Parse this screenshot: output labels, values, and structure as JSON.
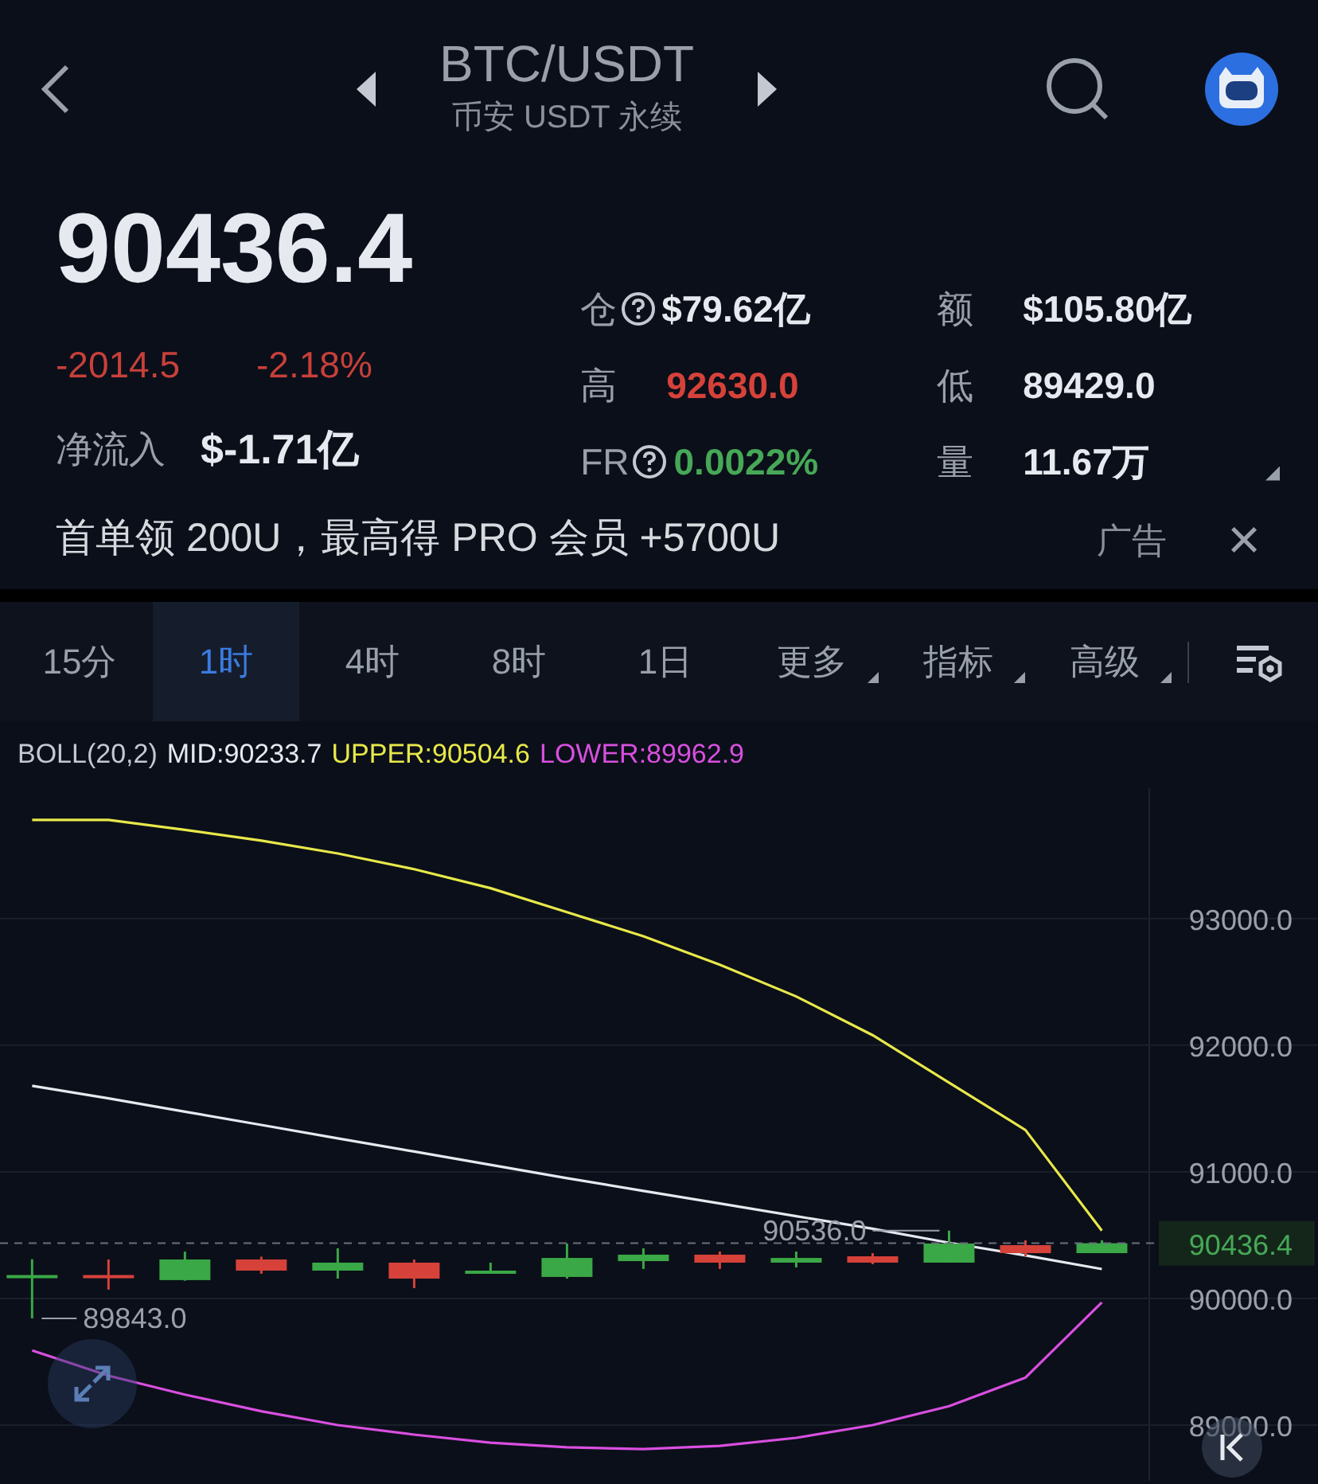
{
  "header": {
    "title": "BTC/USDT",
    "subtitle": "币安 USDT 永续"
  },
  "ticker": {
    "price": "90436.4",
    "change": "-2014.5",
    "change_pct": "-2.18%",
    "netflow_label": "净流入",
    "netflow_value": "$-1.71亿"
  },
  "stats": [
    {
      "label": "仓",
      "help": true,
      "value": "$79.62亿",
      "color": "#e6e9ef"
    },
    {
      "label": "额",
      "help": false,
      "value": "$105.80亿",
      "color": "#e6e9ef"
    },
    {
      "label": "高",
      "help": false,
      "value": "92630.0",
      "color": "#d6423a"
    },
    {
      "label": "低",
      "help": false,
      "value": "89429.0",
      "color": "#e6e9ef"
    },
    {
      "label": "FR",
      "help": true,
      "value": "0.0022%",
      "color": "#46a857"
    },
    {
      "label": "量",
      "help": false,
      "value": "11.67万",
      "color": "#e6e9ef"
    }
  ],
  "banner": {
    "text": "首单领 200U，最高得 PRO 会员 +5700U",
    "ad_label": "广告",
    "close": "×"
  },
  "timeframes": [
    {
      "label": "15分",
      "selected": false,
      "dropdown": false
    },
    {
      "label": "1时",
      "selected": true,
      "dropdown": false
    },
    {
      "label": "4时",
      "selected": false,
      "dropdown": false
    },
    {
      "label": "8时",
      "selected": false,
      "dropdown": false
    },
    {
      "label": "1日",
      "selected": false,
      "dropdown": false
    },
    {
      "label": "更多",
      "selected": false,
      "dropdown": true
    },
    {
      "label": "指标",
      "selected": false,
      "dropdown": true
    },
    {
      "label": "高级",
      "selected": false,
      "dropdown": true
    }
  ],
  "indicator": [
    {
      "text": "BOLL(20,2)",
      "color": "#c4c8d0"
    },
    {
      "text": "MID:90233.7",
      "color": "#e6e9ef"
    },
    {
      "text": "UPPER:90504.6",
      "color": "#e8e84a"
    },
    {
      "text": "LOWER:89962.9",
      "color": "#d94fe0"
    }
  ],
  "chart_data": {
    "type": "candlestick",
    "categories": [
      null,
      null,
      null,
      null,
      null,
      null,
      null,
      null,
      null,
      null,
      null,
      null,
      null,
      null,
      null
    ],
    "ylim": [
      88560,
      94030
    ],
    "grid": true,
    "yticks": [
      {
        "value": 89000,
        "label": "89000.0"
      },
      {
        "value": 90000,
        "label": "90000.0"
      },
      {
        "value": 91000,
        "label": "91000.0"
      },
      {
        "value": 92000,
        "label": "92000.0"
      },
      {
        "value": 93000,
        "label": "93000.0"
      }
    ],
    "series": [
      {
        "type": "line",
        "color": "#e8e84a",
        "values": [
          93780,
          93780,
          93700,
          93616,
          93515,
          93390,
          93240,
          93050,
          92860,
          92635,
          92385,
          92080,
          91705,
          91330,
          90535
        ]
      },
      {
        "type": "line",
        "color": "#e6e9ef",
        "values": [
          91680,
          91580,
          91475,
          91370,
          91265,
          91160,
          91055,
          90950,
          90850,
          90750,
          90650,
          90550,
          90440,
          90340,
          90233
        ]
      },
      {
        "type": "line",
        "color": "#d94fe0",
        "values": [
          89590,
          89390,
          89240,
          89110,
          89000,
          88925,
          88860,
          88825,
          88810,
          88835,
          88900,
          89000,
          89150,
          89375,
          89970
        ]
      },
      {
        "type": "candlestick",
        "ohlc": [
          [
            90170,
            90310,
            89843,
            90185
          ],
          [
            90185,
            90308,
            90070,
            90170
          ],
          [
            90145,
            90370,
            90140,
            90308
          ],
          [
            90308,
            90330,
            90195,
            90220
          ],
          [
            90220,
            90396,
            90157,
            90283
          ],
          [
            90283,
            90308,
            90082,
            90157
          ],
          [
            90195,
            90283,
            90195,
            90220
          ],
          [
            90170,
            90434,
            90157,
            90320
          ],
          [
            90295,
            90396,
            90233,
            90346
          ],
          [
            90346,
            90371,
            90233,
            90283
          ],
          [
            90283,
            90371,
            90245,
            90320
          ],
          [
            90333,
            90358,
            90270,
            90283
          ],
          [
            90283,
            90536,
            90283,
            90434
          ],
          [
            90421,
            90459,
            90333,
            90358
          ],
          [
            90358,
            90459,
            90358,
            90436.4
          ]
        ]
      }
    ],
    "ref_lines": [
      {
        "axis": "y",
        "value": 90436.4,
        "label": "90436.4"
      }
    ],
    "annotations": [
      "90536.0",
      "89843.0"
    ]
  }
}
